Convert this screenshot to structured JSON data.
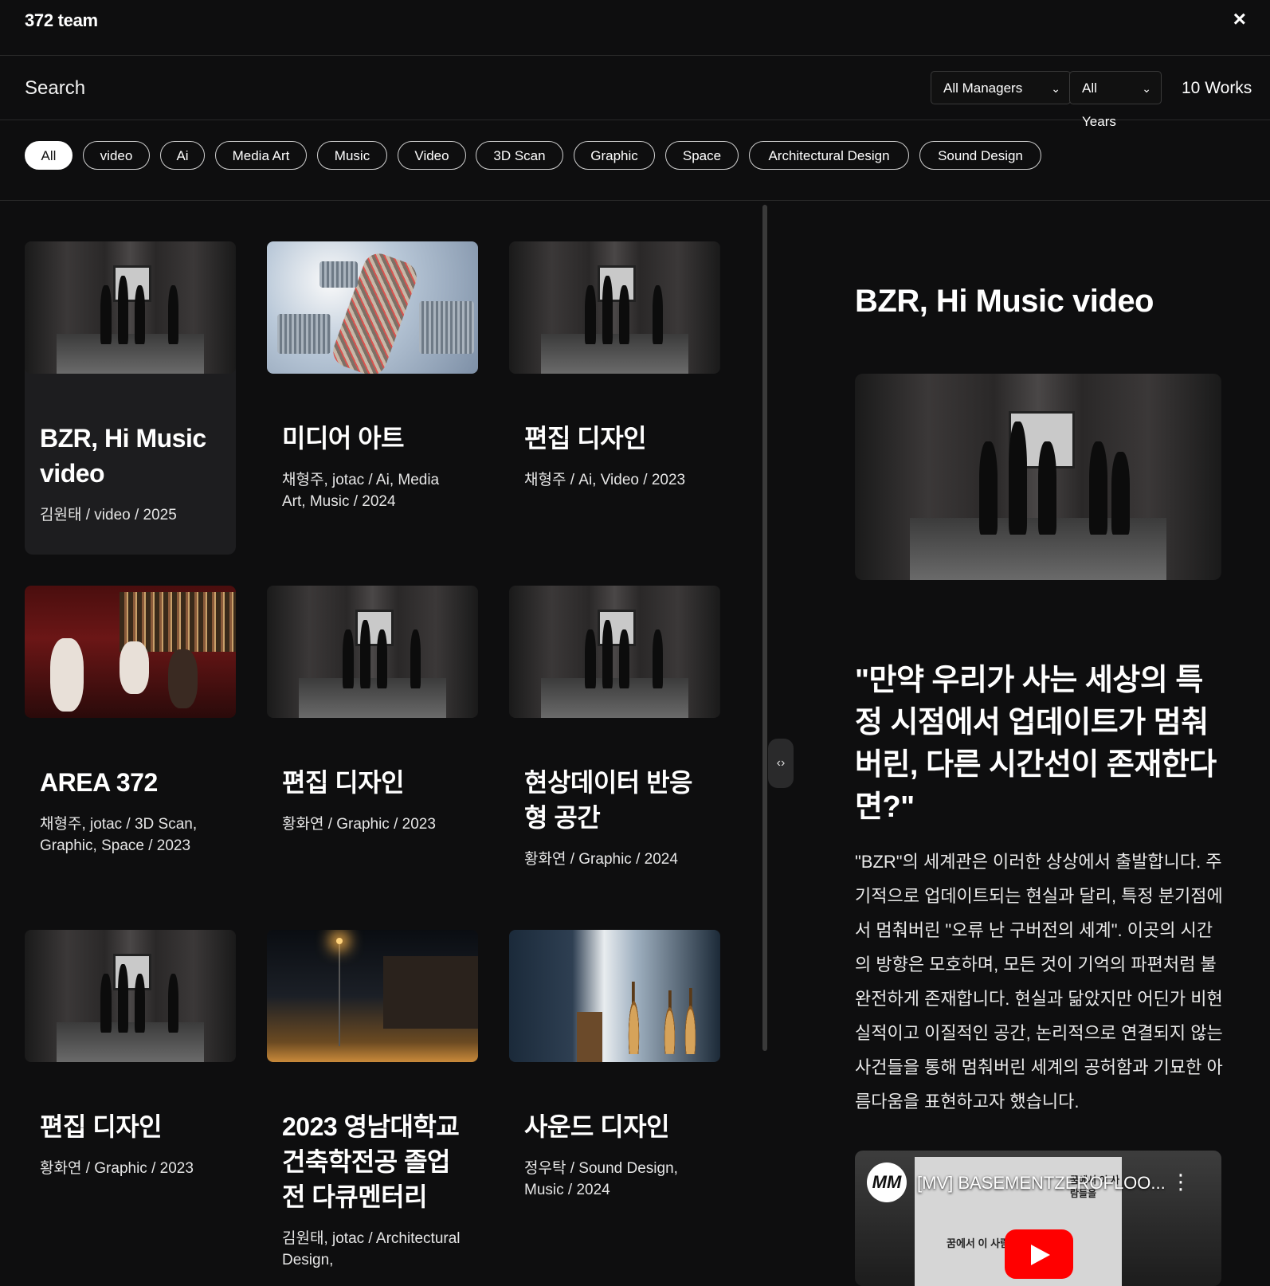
{
  "header": {
    "team_title": "372 team",
    "close_icon": "×"
  },
  "search": {
    "label": "Search",
    "managers_select": "All Managers",
    "years_select": "All Years",
    "works_count": "10 Works"
  },
  "categories": [
    "All",
    "video",
    "Ai",
    "Media Art",
    "Music",
    "Video",
    "3D Scan",
    "Graphic",
    "Space",
    "Architectural Design",
    "Sound Design"
  ],
  "active_category": "All",
  "works": [
    {
      "title": "BZR, Hi Music video",
      "meta": "김원태 / video / 2025",
      "selected": true
    },
    {
      "title": "미디어 아트",
      "meta": "채형주, jotac / Ai, Media Art, Music / 2024"
    },
    {
      "title": "편집 디자인",
      "meta": "채형주 / Ai, Video / 2023"
    },
    {
      "title": "AREA 372",
      "meta": "채형주, jotac / 3D Scan, Graphic, Space / 2023"
    },
    {
      "title": "편집 디자인",
      "meta": "황화연 / Graphic / 2023"
    },
    {
      "title": "현상데이터 반응형 공간",
      "meta": "황화연 / Graphic / 2024"
    },
    {
      "title": "편집 디자인",
      "meta": "황화연 / Graphic / 2023"
    },
    {
      "title": "2023 영남대학교 건축학전공 졸업전 다큐멘터리",
      "meta": "김원태, jotac / Architectural Design,"
    },
    {
      "title": "사운드 디자인",
      "meta": "정우탁 / Sound Design, Music / 2024"
    }
  ],
  "detail": {
    "title": "BZR, Hi Music video",
    "quote": "\"만약 우리가 사는 세상의 특정 시점에서 업데이트가 멈춰버린, 다른 시간선이 존재한다면?\"",
    "body": "\"BZR\"의 세계관은 이러한 상상에서 출발합니다. 주기적으로 업데이트되는 현실과 달리, 특정 분기점에서 멈춰버린 \"오류 난 구버전의 세계\". 이곳의 시간의 방향은 모호하며, 모든 것이 기억의 파편처럼 불완전하게 존재합니다. 현실과 닮았지만 어딘가 비현실적이고 이질적인 공간, 논리적으로 연결되지 않는 사건들을 통해 멈춰버린 세계의 공허함과 기묘한 아름다움을 표현하고자 했습니다.",
    "video": {
      "channel_logo": "MM",
      "title": "[MV] BASEMENTZEROFLOO...",
      "poster_text_1": "꿈에서 이 사람들을",
      "poster_text_2": "꿈에서 이 사람들을"
    }
  }
}
